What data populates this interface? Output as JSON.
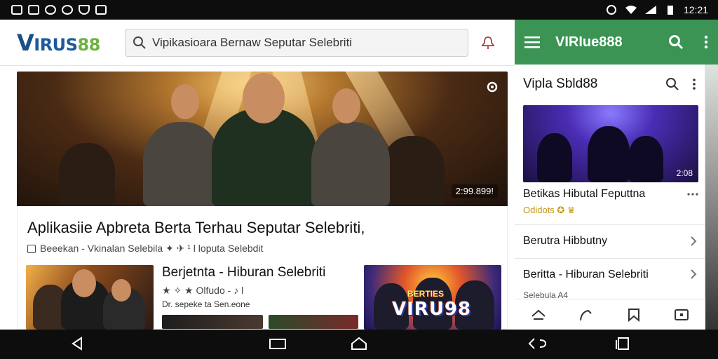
{
  "status": {
    "time": "12:21"
  },
  "header": {
    "logo_v": "V",
    "logo_rest": "IRUS",
    "logo_num": "88",
    "search_placeholder": "Vipikasioara Bernaw Seputar Selebriti"
  },
  "hero": {
    "duration": "2:99.899!"
  },
  "article": {
    "title": "Aplikasiie Apbreta Berta Terhau Seputar Selebriti,",
    "meta": "Beeekan - Vkinalan Selebila ✦ ✈ ¹ l loputa Selebdit"
  },
  "related": {
    "title": "Berjetnta - Hiburan Selebriti",
    "rating": "★ ✧ ★ Olfudo - ♪ l",
    "sub": "Dr. sepeke ta Sen.eone"
  },
  "promo": {
    "small": "BERTIES",
    "big": "VIRU98"
  },
  "side": {
    "brand": "VIRIue888",
    "card_title": "Vipla Sbld88",
    "video_time": "2:08",
    "caption": "Betikas Hibutal Feputtna",
    "caption_tags": "Odidots ✪ ♛",
    "row1": "Berutra Hibbutny",
    "row2": "Beritta - Hiburan Selebriti",
    "row2_sub": "Selebula  A4"
  },
  "colors": {
    "brand_green": "#3b9454",
    "logo_blue": "#1d5a99",
    "logo_green": "#6db33f"
  }
}
